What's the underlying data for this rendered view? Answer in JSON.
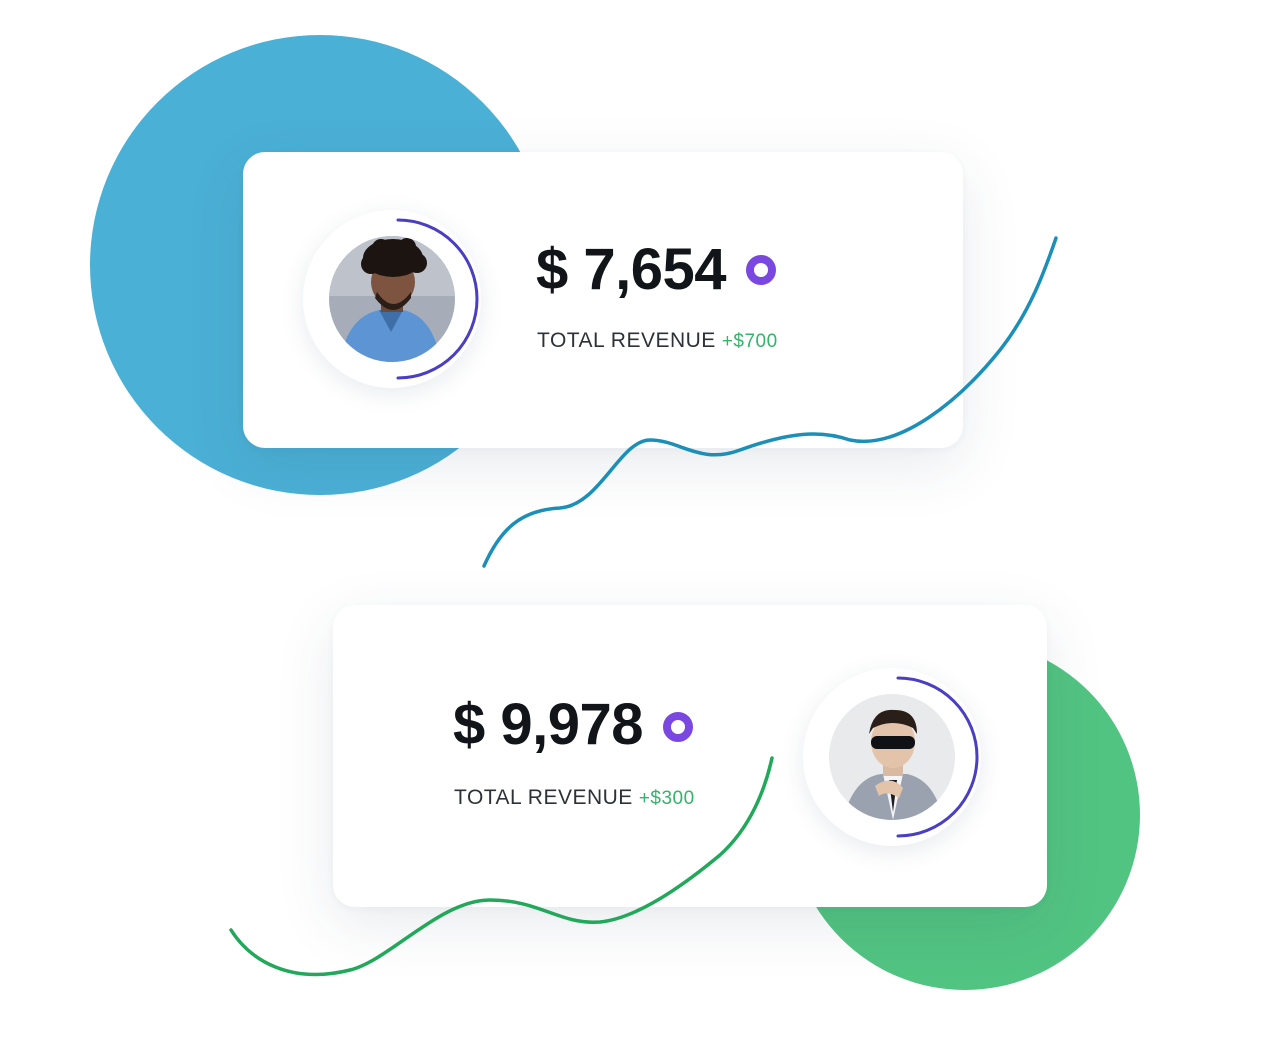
{
  "colors": {
    "blue_blob": "#4bb0d6",
    "green_blob": "#52c482",
    "ring": "#4a3fc4",
    "status_dot": "#7a48e0",
    "delta": "#34b36a",
    "blue_line": "#1b8fb8",
    "green_line": "#21a85b"
  },
  "cards": [
    {
      "amount": "$ 7,654",
      "label": "TOTAL REVENUE",
      "delta": "+$700",
      "avatar_icon": "person-curly-hair-icon"
    },
    {
      "amount": "$ 9,978",
      "label": "TOTAL REVENUE",
      "delta": "+$300",
      "avatar_icon": "person-sunglasses-icon"
    }
  ]
}
